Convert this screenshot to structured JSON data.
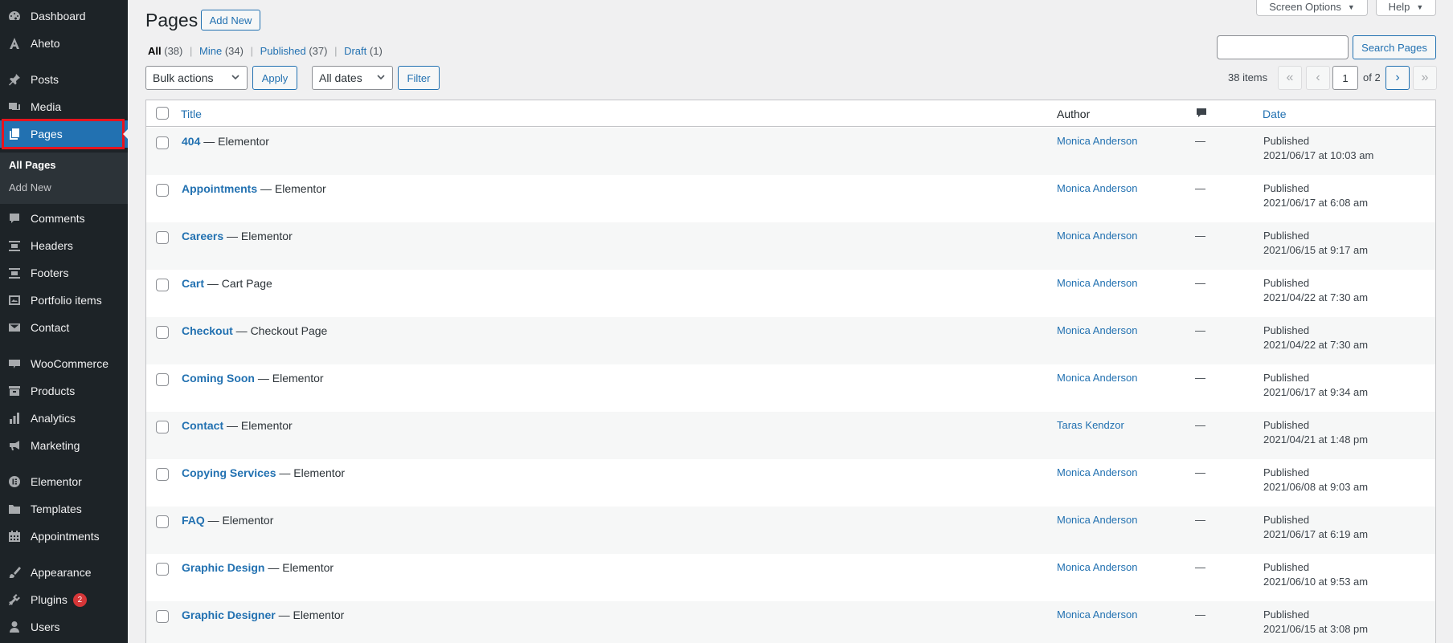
{
  "sidebar": {
    "items": [
      {
        "label": "Dashboard",
        "icon": "dashboard-icon"
      },
      {
        "label": "Aheto",
        "icon": "aheto-icon"
      },
      {
        "label": "Posts",
        "icon": "pin-icon"
      },
      {
        "label": "Media",
        "icon": "media-icon"
      },
      {
        "label": "Pages",
        "icon": "pages-icon"
      },
      {
        "label": "Comments",
        "icon": "comment-icon"
      },
      {
        "label": "Headers",
        "icon": "header-icon"
      },
      {
        "label": "Footers",
        "icon": "footer-icon"
      },
      {
        "label": "Portfolio items",
        "icon": "portfolio-icon"
      },
      {
        "label": "Contact",
        "icon": "mail-icon"
      },
      {
        "label": "WooCommerce",
        "icon": "woocommerce-icon"
      },
      {
        "label": "Products",
        "icon": "products-icon"
      },
      {
        "label": "Analytics",
        "icon": "analytics-icon"
      },
      {
        "label": "Marketing",
        "icon": "megaphone-icon"
      },
      {
        "label": "Elementor",
        "icon": "elementor-icon"
      },
      {
        "label": "Templates",
        "icon": "folder-icon"
      },
      {
        "label": "Appointments",
        "icon": "calendar-icon"
      },
      {
        "label": "Appearance",
        "icon": "brush-icon"
      },
      {
        "label": "Plugins",
        "icon": "plugin-icon",
        "badge": "2"
      },
      {
        "label": "Users",
        "icon": "user-icon"
      }
    ],
    "submenu": [
      {
        "label": "All Pages"
      },
      {
        "label": "Add New"
      }
    ]
  },
  "header": {
    "title": "Pages",
    "add_new": "Add New",
    "screen_options": "Screen Options",
    "help": "Help"
  },
  "filters": {
    "all": "All",
    "all_count": "(38)",
    "mine": "Mine",
    "mine_count": "(34)",
    "published": "Published",
    "published_count": "(37)",
    "draft": "Draft",
    "draft_count": "(1)",
    "sep": "|"
  },
  "search": {
    "button": "Search Pages",
    "value": ""
  },
  "tablenav": {
    "bulk_actions": "Bulk actions",
    "apply": "Apply",
    "dates": "All dates",
    "filter": "Filter",
    "items": "38 items",
    "first": "«",
    "prev": "‹",
    "current_page": "1",
    "of_pages": "of 2",
    "next": "›",
    "last": "»"
  },
  "table": {
    "columns": {
      "title": "Title",
      "author": "Author",
      "date": "Date"
    },
    "rows": [
      {
        "title": "404",
        "suffix": " — Elementor",
        "author": "Monica Anderson",
        "comments": "—",
        "status": "Published",
        "date": "2021/06/17 at 10:03 am"
      },
      {
        "title": "Appointments",
        "suffix": " — Elementor",
        "author": "Monica Anderson",
        "comments": "—",
        "status": "Published",
        "date": "2021/06/17 at 6:08 am"
      },
      {
        "title": "Careers",
        "suffix": " — Elementor",
        "author": "Monica Anderson",
        "comments": "—",
        "status": "Published",
        "date": "2021/06/15 at 9:17 am"
      },
      {
        "title": "Cart",
        "suffix": " — Cart Page",
        "author": "Monica Anderson",
        "comments": "—",
        "status": "Published",
        "date": "2021/04/22 at 7:30 am"
      },
      {
        "title": "Checkout",
        "suffix": " — Checkout Page",
        "author": "Monica Anderson",
        "comments": "—",
        "status": "Published",
        "date": "2021/04/22 at 7:30 am"
      },
      {
        "title": "Coming Soon",
        "suffix": " — Elementor",
        "author": "Monica Anderson",
        "comments": "—",
        "status": "Published",
        "date": "2021/06/17 at 9:34 am"
      },
      {
        "title": "Contact",
        "suffix": " — Elementor",
        "author": "Taras Kendzor",
        "comments": "—",
        "status": "Published",
        "date": "2021/04/21 at 1:48 pm"
      },
      {
        "title": "Copying Services",
        "suffix": " — Elementor",
        "author": "Monica Anderson",
        "comments": "—",
        "status": "Published",
        "date": "2021/06/08 at 9:03 am"
      },
      {
        "title": "FAQ",
        "suffix": " — Elementor",
        "author": "Monica Anderson",
        "comments": "—",
        "status": "Published",
        "date": "2021/06/17 at 6:19 am"
      },
      {
        "title": "Graphic Design",
        "suffix": " — Elementor",
        "author": "Monica Anderson",
        "comments": "—",
        "status": "Published",
        "date": "2021/06/10 at 9:53 am"
      },
      {
        "title": "Graphic Designer",
        "suffix": " — Elementor",
        "author": "Monica Anderson",
        "comments": "—",
        "status": "Published",
        "date": "2021/06/15 at 3:08 pm"
      }
    ]
  },
  "colors": {
    "accent": "#2271b1",
    "sidebar": "#1d2327",
    "highlight": "#e8141e",
    "badge": "#d63638"
  }
}
